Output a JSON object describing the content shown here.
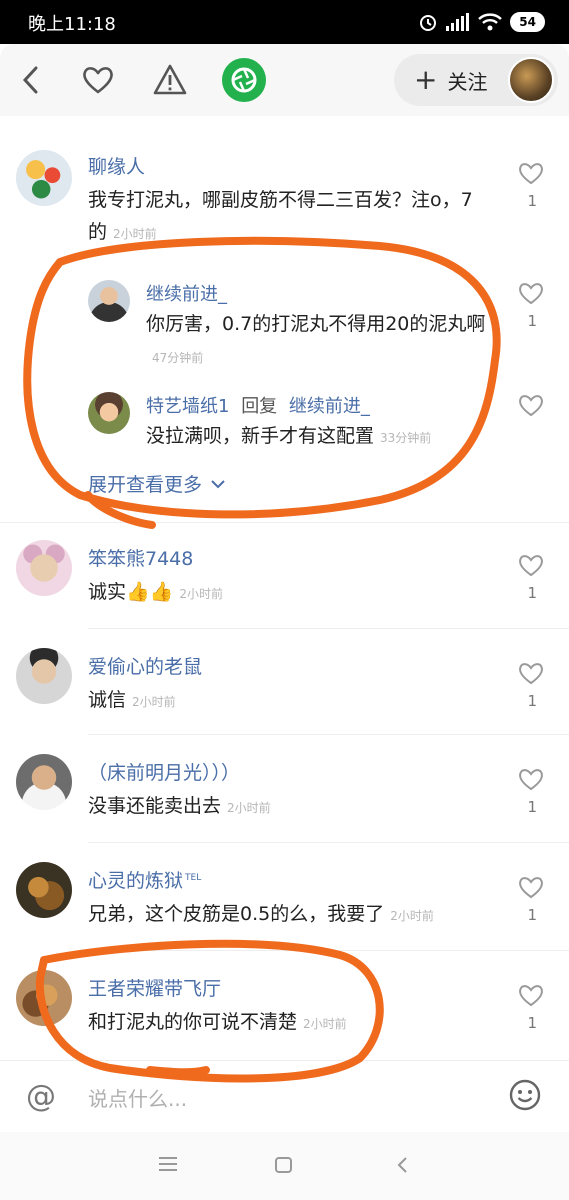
{
  "status_bar": {
    "time": "晚上11:18",
    "battery": "54"
  },
  "header": {
    "follow_label": "关注"
  },
  "comments": [
    {
      "name": "聊缘人",
      "text": "我专打泥丸，哪副皮筋不得二三百发？注o，7的",
      "time": "2小时前",
      "likes": "1"
    },
    {
      "name": "继续前进_",
      "text": "你厉害，0.7的打泥丸不得用20的泥丸啊",
      "time": "47分钟前",
      "likes": "1"
    },
    {
      "name": "特艺墙纸1",
      "reply_word": "回复",
      "reply_to": "继续前进_",
      "text": "没拉满呗，新手才有这配置",
      "time": "33分钟前"
    },
    {
      "name": "笨笨熊7448",
      "text": "诚实👍👍",
      "time": "2小时前",
      "likes": "1"
    },
    {
      "name": "爱偷心的老鼠",
      "text": "诚信",
      "time": "2小时前",
      "likes": "1"
    },
    {
      "name": "（床前明月光）））",
      "text": "没事还能卖出去",
      "time": "2小时前",
      "likes": "1"
    },
    {
      "name": "心灵的炼狱",
      "name_badge": "TEL",
      "text": "兄弟，这个皮筋是0.5的么，我要了",
      "time": "2小时前",
      "likes": "1"
    },
    {
      "name": "王者荣耀带飞厅",
      "text": "和打泥丸的你可说不清楚",
      "time": "2小时前",
      "likes": "1"
    }
  ],
  "expand_label": "展开查看更多",
  "input": {
    "placeholder": "说点什么..."
  },
  "colors": {
    "name_blue": "#4a6ea8",
    "accent_green": "#22b14c",
    "annotation_orange": "#f06a1e"
  },
  "icons": [
    "back-icon",
    "heart-icon",
    "warning-icon",
    "camera-shutter-icon",
    "plus-icon",
    "at-icon",
    "emoji-icon",
    "menu-icon",
    "home-icon",
    "back-nav-icon"
  ]
}
